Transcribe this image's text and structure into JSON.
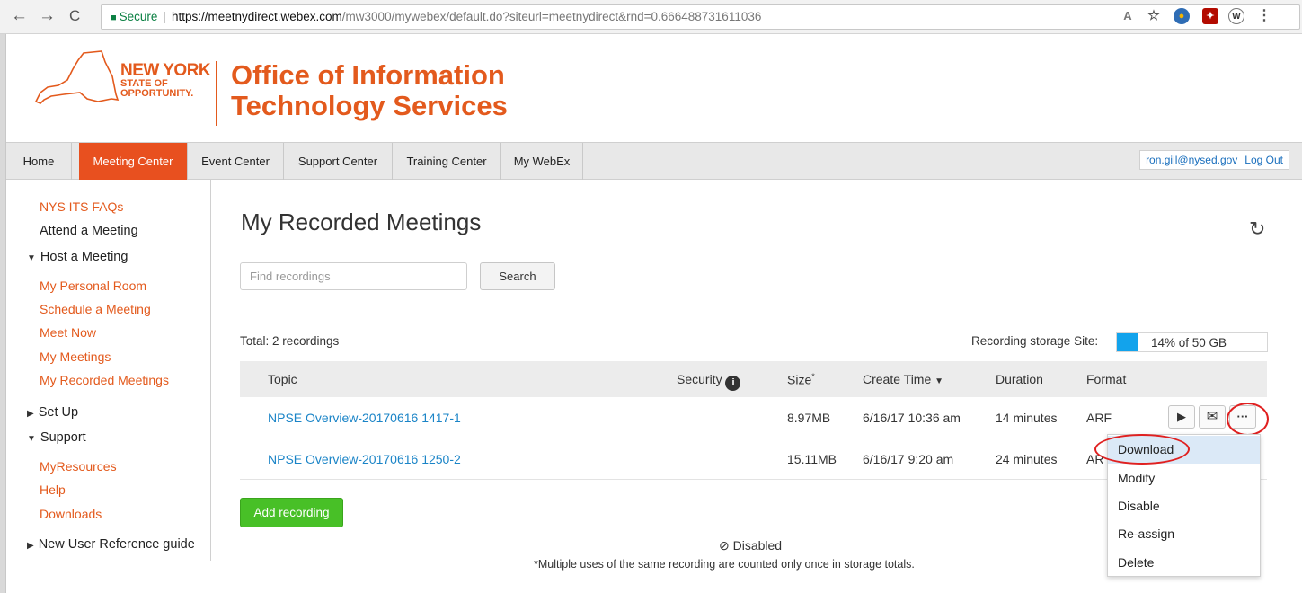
{
  "browser": {
    "secure_label": "Secure",
    "url_host": "https://meetnydirect.webex.com",
    "url_path": "/mw3000/mywebex/default.do?siteurl=meetnydirect&rnd=0.666488731611036"
  },
  "header": {
    "ny_line1": "NEW YORK",
    "ny_line2": "STATE OF",
    "ny_line3": "OPPORTUNITY.",
    "office_line1": "Office of Information",
    "office_line2": "Technology Services"
  },
  "tabs": [
    {
      "label": "Home"
    },
    {
      "label": "Meeting Center"
    },
    {
      "label": "Event Center"
    },
    {
      "label": "Support Center"
    },
    {
      "label": "Training Center"
    },
    {
      "label": "My WebEx"
    }
  ],
  "user": {
    "email": "ron.gill@nysed.gov",
    "logout": "Log Out"
  },
  "sidebar": {
    "faqs": "NYS ITS FAQs",
    "attend": "Attend a Meeting",
    "host_section": "Host a Meeting",
    "host_items": [
      "My Personal Room",
      "Schedule a Meeting",
      "Meet Now",
      "My Meetings",
      "My Recorded Meetings"
    ],
    "setup_section": "Set Up",
    "support_section": "Support",
    "support_items": [
      "MyResources",
      "Help",
      "Downloads"
    ],
    "guide_section": "New User Reference guide"
  },
  "main": {
    "title": "My Recorded Meetings",
    "search_placeholder": "Find recordings",
    "search_button": "Search",
    "total": "Total: 2 recordings",
    "storage_label": "Recording storage Site:",
    "storage_text": "14% of 50 GB",
    "storage_percent": 14,
    "columns": {
      "topic": "Topic",
      "security": "Security",
      "size": "Size",
      "size_mark": "*",
      "create": "Create Time",
      "duration": "Duration",
      "format": "Format"
    },
    "rows": [
      {
        "topic": "NPSE Overview-20170616 1417-1",
        "size": "8.97MB",
        "create": "6/16/17 10:36 am",
        "duration": "14 minutes",
        "format": "ARF"
      },
      {
        "topic": "NPSE Overview-20170616 1250-2",
        "size": "15.11MB",
        "create": "6/16/17 9:20 am",
        "duration": "24 minutes",
        "format": "AR"
      }
    ],
    "add_button": "Add recording",
    "disabled_note": "⊘ Disabled",
    "footnote": "*Multiple uses of the same recording are counted only once in storage totals."
  },
  "menu": {
    "items": [
      "Download",
      "Modify",
      "Disable",
      "Re-assign",
      "Delete"
    ]
  },
  "colors": {
    "brand": "#e35a1d",
    "active_tab": "#e8501f",
    "link": "#1a84c7",
    "add_button": "#48c027",
    "storage": "#12a3ec",
    "annotation": "#e02020"
  }
}
